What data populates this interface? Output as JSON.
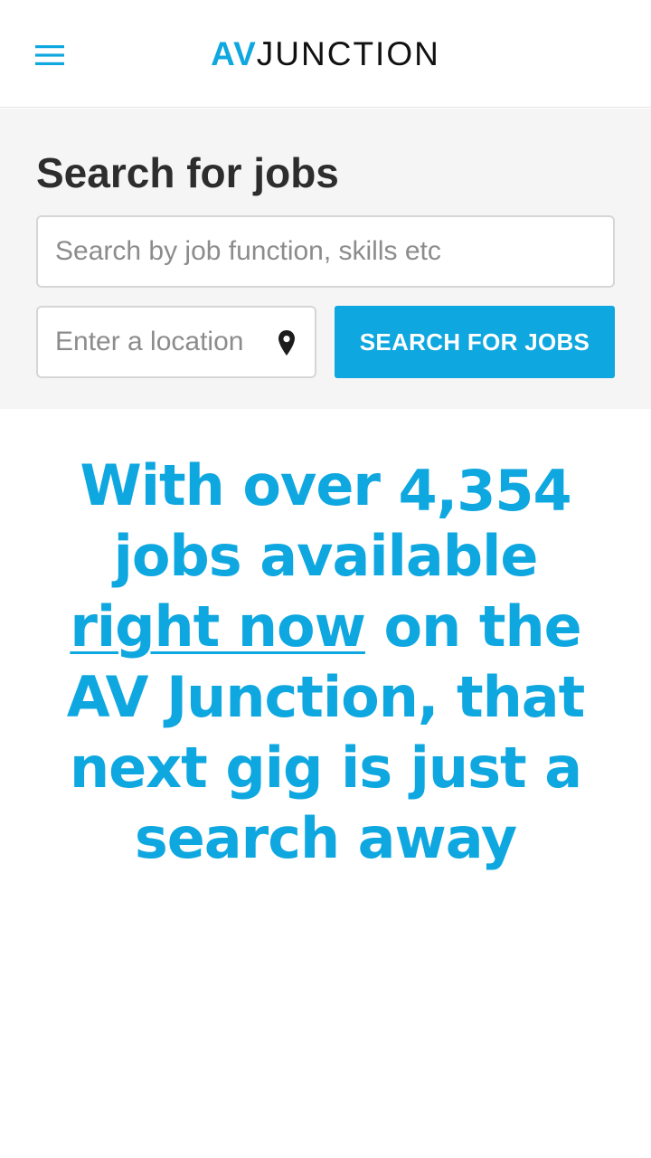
{
  "header": {
    "logo_av": "AV",
    "logo_junction": "JUNCTION",
    "menu_icon": "hamburger-menu-icon"
  },
  "search": {
    "title": "Search for jobs",
    "keyword_placeholder": "Search by job function, skills etc",
    "keyword_value": "",
    "location_placeholder": "Enter a location",
    "location_value": "",
    "location_icon": "map-pin-icon",
    "button_label": "SEARCH FOR JOBS"
  },
  "headline": {
    "prefix": "With over ",
    "job_count": "4,354",
    "middle": " jobs available ",
    "link_text": "right now",
    "suffix": " on the AV Junction, that next gig is just a search away"
  },
  "colors": {
    "accent": "#0fa7e0",
    "panel_background": "#f5f5f5",
    "title_text": "#2d2d2d"
  }
}
